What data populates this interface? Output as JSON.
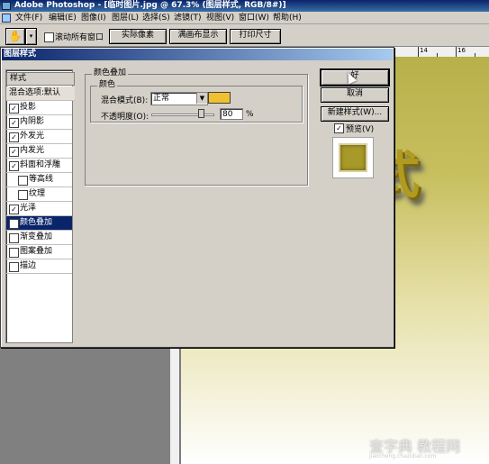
{
  "app": {
    "title": "Adobe Photoshop - [临时图片.jpg @ 67.3% (图层样式, RGB/8#)]"
  },
  "menubar": {
    "items": [
      "文件(F)",
      "编辑(E)",
      "图像(I)",
      "图层(L)",
      "选择(S)",
      "滤镜(T)",
      "视图(V)",
      "窗口(W)",
      "帮助(H)"
    ]
  },
  "options_bar": {
    "scroll_all_label": "滚动所有窗口",
    "actual_pixels": "实际像素",
    "fit_screen": "满画布显示",
    "print_size": "打印尺寸"
  },
  "ruler": {
    "labels": [
      "14",
      "16"
    ]
  },
  "dialog": {
    "title": "图层样式",
    "styles_header": "样式",
    "blend_options": "混合选项:默认",
    "items": [
      {
        "label": "投影",
        "checked": true
      },
      {
        "label": "内阴影",
        "checked": true
      },
      {
        "label": "外发光",
        "checked": true
      },
      {
        "label": "内发光",
        "checked": true
      },
      {
        "label": "斜面和浮雕",
        "checked": true
      },
      {
        "label": "等高线",
        "checked": false
      },
      {
        "label": "纹理",
        "checked": false
      },
      {
        "label": "光泽",
        "checked": true
      },
      {
        "label": "颜色叠加",
        "checked": true,
        "selected": true
      },
      {
        "label": "渐变叠加",
        "checked": false
      },
      {
        "label": "图案叠加",
        "checked": false
      },
      {
        "label": "描边",
        "checked": false
      }
    ],
    "group_title": "颜色叠加",
    "subgroup_title": "颜色",
    "blend_mode_label": "混合模式(B):",
    "blend_mode_value": "正常",
    "overlay_color": "#f0c030",
    "opacity_label": "不透明度(O):",
    "opacity_value": "80",
    "opacity_fraction": 0.8,
    "opacity_unit": "%",
    "ok": "好",
    "cancel": "取消",
    "new_style": "新建样式(W)...",
    "preview_label": "预览(V)",
    "preview_checked": true
  },
  "canvas": {
    "text": "式",
    "watermark": "查字典 教程网",
    "watermark_url": "jiaocheng.chazidian.com"
  }
}
